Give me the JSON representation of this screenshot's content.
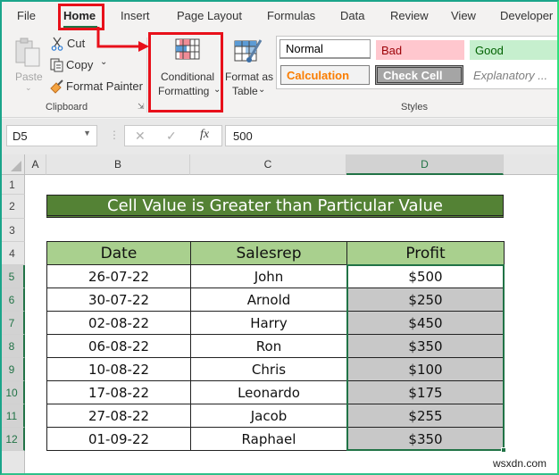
{
  "menu": {
    "tabs": [
      {
        "label": "File"
      },
      {
        "label": "Home",
        "active": true
      },
      {
        "label": "Insert"
      },
      {
        "label": "Page Layout"
      },
      {
        "label": "Formulas"
      },
      {
        "label": "Data"
      },
      {
        "label": "Review"
      },
      {
        "label": "View"
      },
      {
        "label": "Developer"
      }
    ]
  },
  "ribbon": {
    "clipboard": {
      "paste": "Paste",
      "cut": "Cut",
      "copy": "Copy",
      "format_painter": "Format Painter",
      "group_label": "Clipboard"
    },
    "conditional_formatting": {
      "line1": "Conditional",
      "line2": "Formatting"
    },
    "format_as_table": {
      "line1": "Format as",
      "line2": "Table"
    },
    "styles": {
      "group_label": "Styles",
      "items": [
        {
          "label": "Normal",
          "bg": "#ffffff",
          "color": "#222222"
        },
        {
          "label": "Bad",
          "bg": "#ffc7ce",
          "color": "#9c0006"
        },
        {
          "label": "Good",
          "bg": "#c6efce",
          "color": "#006100"
        },
        {
          "label": "Calculation",
          "bg": "#f2f2f2",
          "color": "#fa7d00"
        },
        {
          "label": "Check Cell",
          "bg": "#a5a5a5",
          "color": "#ffffff"
        },
        {
          "label": "Explanatory ...",
          "bg": "#ffffff",
          "color": "#7f7f7f"
        }
      ]
    }
  },
  "formula_bar": {
    "name_box": "D5",
    "formula": "500"
  },
  "grid": {
    "columns": [
      "A",
      "B",
      "C",
      "D"
    ],
    "rows": [
      "1",
      "2",
      "3",
      "4",
      "5",
      "6",
      "7",
      "8",
      "9",
      "10",
      "11",
      "12"
    ],
    "selected_column": "D",
    "title": "Cell Value is Greater than Particular Value",
    "table": {
      "headers": [
        "Date",
        "Salesrep",
        "Profit"
      ],
      "rows": [
        [
          "26-07-22",
          "John",
          "$500"
        ],
        [
          "30-07-22",
          "Arnold",
          "$250"
        ],
        [
          "02-08-22",
          "Harry",
          "$450"
        ],
        [
          "06-08-22",
          "Ron",
          "$350"
        ],
        [
          "10-08-22",
          "Chris",
          "$100"
        ],
        [
          "17-08-22",
          "Leonardo",
          "$175"
        ],
        [
          "27-08-22",
          "Jacob",
          "$255"
        ],
        [
          "01-09-22",
          "Raphael",
          "$350"
        ]
      ],
      "shaded_rows_profit": [
        false,
        true,
        true,
        true,
        true,
        true,
        true,
        true
      ]
    }
  },
  "colors": {
    "accent_green": "#217346",
    "title_bg": "#548235",
    "header_bg": "#a9d08e",
    "shaded_cell": "#c8c8c8",
    "highlight_red": "#e8101a"
  },
  "watermark": "wsxdn.com"
}
